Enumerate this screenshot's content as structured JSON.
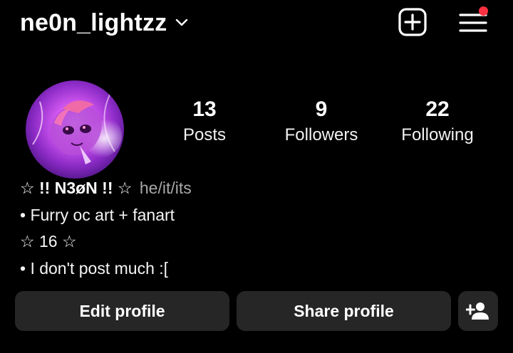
{
  "header": {
    "username": "ne0n_lightzz",
    "username_dropdown_icon": "chevron-down-icon",
    "create_icon": "plus-square-icon",
    "menu_icon": "hamburger-menu-icon",
    "menu_has_notification": true,
    "notification_color": "#ff3040"
  },
  "stats": {
    "posts": {
      "value": "13",
      "label": "Posts"
    },
    "followers": {
      "value": "9",
      "label": "Followers"
    },
    "following": {
      "value": "22",
      "label": "Following"
    }
  },
  "bio": {
    "name": "☆ !! N3øN !! ☆",
    "pronouns": "he/it/its",
    "lines": [
      "• Furry oc art + fanart",
      "☆ 16 ☆",
      "• I don't post much :["
    ]
  },
  "actions": {
    "edit_profile": "Edit profile",
    "share_profile": "Share profile",
    "add_person_icon": "add-person-icon"
  },
  "colors": {
    "background": "#000000",
    "button_bg": "#262626",
    "pronouns_text": "#a8a8a8",
    "avatar_glow": "#c23fe0"
  }
}
